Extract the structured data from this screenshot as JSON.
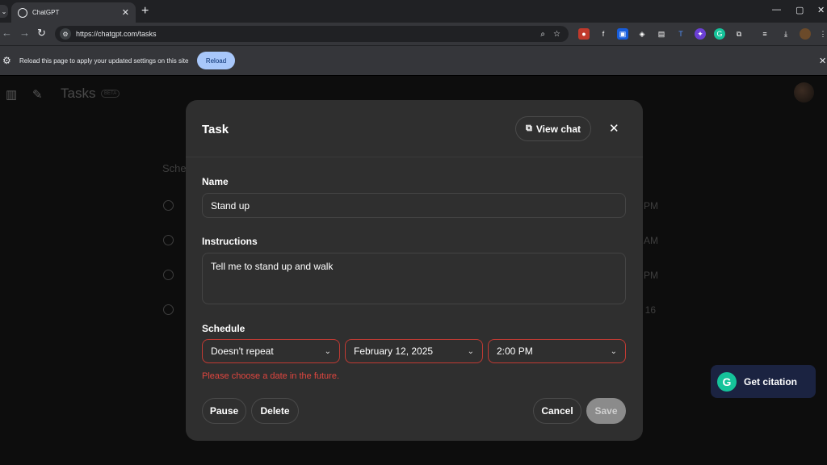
{
  "browser": {
    "tab_title": "ChatGPT",
    "url": "https://chatgpt.com/tasks",
    "infobar_message": "Reload this page to apply your updated settings on this site",
    "reload_label": "Reload"
  },
  "page": {
    "title": "Tasks",
    "beta_badge": "BETA",
    "section_heading": "Sche",
    "bg_times": [
      "PM",
      "AM",
      "PM",
      "/ 16"
    ]
  },
  "modal": {
    "title": "Task",
    "view_chat_label": "View chat",
    "name_label": "Name",
    "name_value": "Stand up",
    "instructions_label": "Instructions",
    "instructions_value": "Tell me to stand up and walk",
    "schedule_label": "Schedule",
    "repeat_value": "Doesn't repeat",
    "date_value": "February 12, 2025",
    "time_value": "2:00 PM",
    "error_message": "Please choose a date in the future.",
    "pause_label": "Pause",
    "delete_label": "Delete",
    "cancel_label": "Cancel",
    "save_label": "Save"
  },
  "citation": {
    "logo_letter": "G",
    "label": "Get citation"
  },
  "colors": {
    "error": "#e0463f",
    "error_border": "#c13a33",
    "reload_button": "#a8c7fa",
    "grammarly_green": "#15c39a"
  },
  "icons": [
    "chevron-down-icon",
    "chatgpt-favicon",
    "close-icon",
    "plus-icon",
    "minimize-icon",
    "maximize-icon",
    "back-icon",
    "forward-icon",
    "reload-icon",
    "site-settings-icon",
    "zoom-icon",
    "star-icon",
    "gear-icon",
    "sidebar-icon",
    "new-chat-icon",
    "clock-icon",
    "view-chat-icon"
  ]
}
